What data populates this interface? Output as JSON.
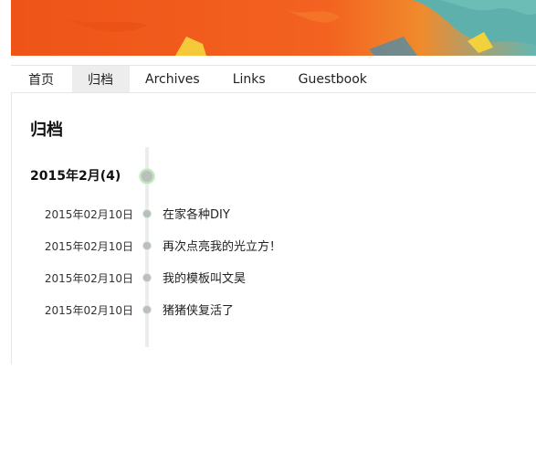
{
  "nav": {
    "items": [
      {
        "label": "首页"
      },
      {
        "label": "归档"
      },
      {
        "label": "Archives"
      },
      {
        "label": "Links"
      },
      {
        "label": "Guestbook"
      }
    ]
  },
  "page": {
    "title": "归档"
  },
  "archive": {
    "month_label": "2015年2月(4)",
    "posts": [
      {
        "date": "2015年02月10日",
        "title": "在家各种DIY"
      },
      {
        "date": "2015年02月10日",
        "title": "再次点亮我的光立方！"
      },
      {
        "date": "2015年02月10日",
        "title": "我的模板叫文昊"
      },
      {
        "date": "2015年02月10日",
        "title": "猪猪侠复活了"
      }
    ]
  },
  "colors": {
    "banner_orange": "#f05a18",
    "banner_teal": "#5fb3b0",
    "active_tab_bg": "#ededed",
    "timeline_dot_ring": "#b9e7b9"
  }
}
